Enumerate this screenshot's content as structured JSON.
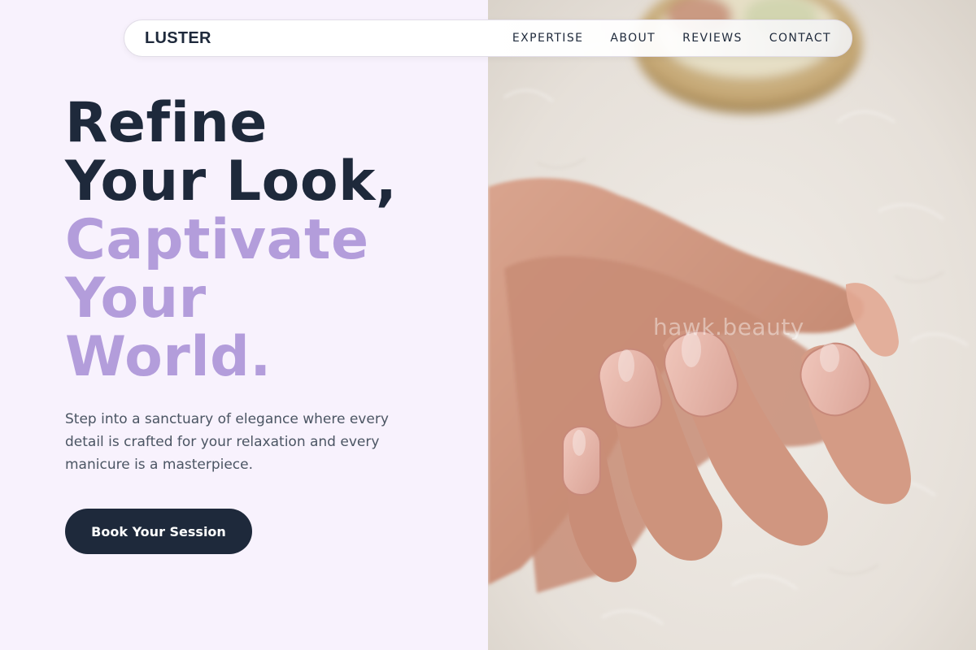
{
  "nav": {
    "brand": "LUSTER",
    "links": [
      "EXPERTISE",
      "ABOUT",
      "REVIEWS",
      "CONTACT"
    ]
  },
  "hero": {
    "title_lines": [
      "Refine",
      "Your Look,"
    ],
    "accent_lines": [
      "Captivate",
      "Your",
      "World."
    ],
    "description": "Step into a sanctuary of elegance where every detail is crafted for your relaxation and every manicure is a masterpiece.",
    "cta_label": "Book Your Session"
  },
  "photo": {
    "watermark": "hawk.beauty",
    "subject": "hand with nude manicured nails resting on white fluffy fur"
  },
  "colors": {
    "background": "#f8f2fd",
    "heading": "#1e293b",
    "accent": "#b39ddb",
    "body_text": "#4b5563",
    "button": "#1e293b"
  }
}
